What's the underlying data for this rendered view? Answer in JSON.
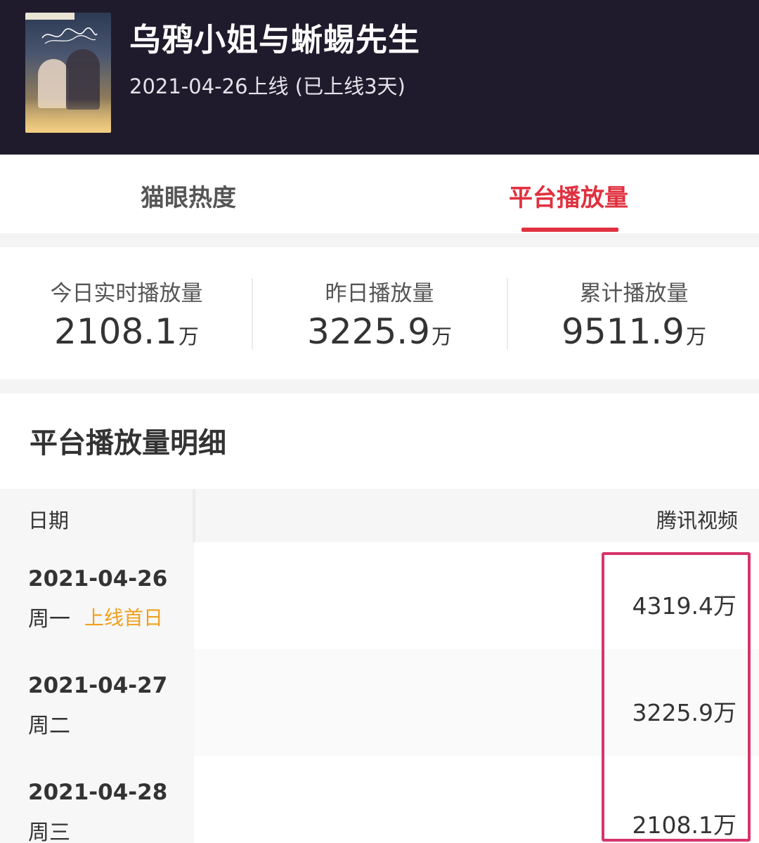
{
  "header": {
    "title": "乌鸦小姐与蜥蜴先生",
    "subtitle": "2021-04-26上线 (已上线3天)",
    "poster_icon": "drama-poster-image"
  },
  "tabs": [
    {
      "label": "猫眼热度",
      "active": false
    },
    {
      "label": "平台播放量",
      "active": true
    }
  ],
  "accent_color": "#e0313f",
  "stats": [
    {
      "label": "今日实时播放量",
      "value": "2108.1",
      "unit": "万"
    },
    {
      "label": "昨日播放量",
      "value": "3225.9",
      "unit": "万"
    },
    {
      "label": "累计播放量",
      "value": "9511.9",
      "unit": "万"
    }
  ],
  "detail": {
    "title": "平台播放量明细",
    "columns": [
      "日期",
      "腾讯视频"
    ],
    "rows": [
      {
        "date": "2021-04-26",
        "weekday": "周一",
        "tag": "上线首日",
        "tencent": "4319.4万"
      },
      {
        "date": "2021-04-27",
        "weekday": "周二",
        "tag": "",
        "tencent": "3225.9万"
      },
      {
        "date": "2021-04-28",
        "weekday": "周三",
        "tag": "",
        "tencent": "2108.1万"
      }
    ],
    "highlight_color": "#d6356b",
    "tag_color": "#f0a020"
  }
}
